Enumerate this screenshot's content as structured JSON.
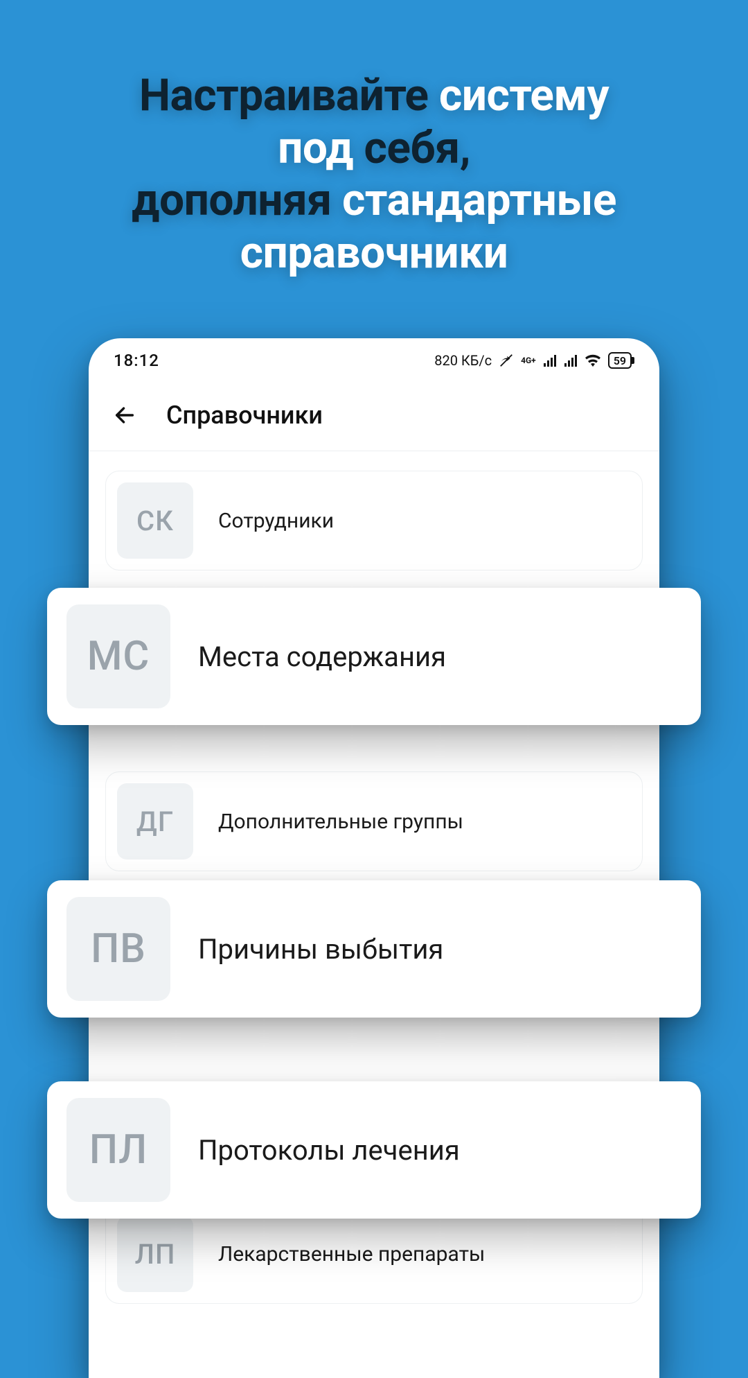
{
  "promo": {
    "l1a": "Настраивайте ",
    "l1b": "систему",
    "l2a": "под ",
    "l2b": "себя,",
    "l3a": "дополняя ",
    "l3b": "стандартные",
    "l4": "справочники"
  },
  "statusbar": {
    "time": "18:12",
    "speed": "820 КБ/с",
    "net_label": "4G+",
    "battery": "59"
  },
  "appbar": {
    "title": "Справочники"
  },
  "items": {
    "sk": {
      "abbr": "СК",
      "label": "Сотрудники"
    },
    "ms": {
      "abbr": "МС",
      "label": "Места содержания"
    },
    "dg": {
      "abbr": "ДГ",
      "label": "Дополнительные группы"
    },
    "pv": {
      "abbr": "ПВ",
      "label": "Причины выбытия"
    },
    "pl": {
      "abbr": "ПЛ",
      "label": "Протоколы лечения"
    },
    "lp": {
      "abbr": "ЛП",
      "label": "Лекарственные препараты"
    }
  }
}
